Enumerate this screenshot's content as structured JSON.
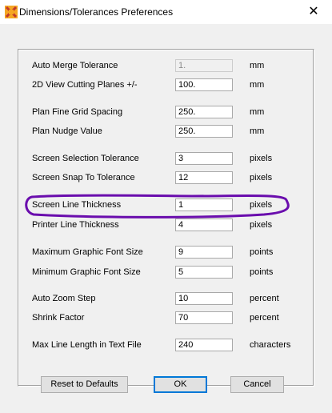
{
  "window": {
    "title": "Dimensions/Tolerances Preferences",
    "close_glyph": "✕",
    "icon": "app-icon"
  },
  "rows": [
    {
      "label": "Auto Merge Tolerance",
      "value": "1.",
      "unit": "mm",
      "disabled": true
    },
    {
      "label": "2D View Cutting Planes +/-",
      "value": "100.",
      "unit": "mm",
      "disabled": false
    },
    {
      "label": "Plan Fine Grid Spacing",
      "value": "250.",
      "unit": "mm",
      "disabled": false
    },
    {
      "label": "Plan Nudge Value",
      "value": "250.",
      "unit": "mm",
      "disabled": false
    },
    {
      "label": "Screen Selection Tolerance",
      "value": "3",
      "unit": "pixels",
      "disabled": false
    },
    {
      "label": "Screen Snap To Tolerance",
      "value": "12",
      "unit": "pixels",
      "disabled": false
    },
    {
      "label": "Screen Line Thickness",
      "value": "1",
      "unit": "pixels",
      "disabled": false
    },
    {
      "label": "Printer Line Thickness",
      "value": "4",
      "unit": "pixels",
      "disabled": false
    },
    {
      "label": "Maximum Graphic Font Size",
      "value": "9",
      "unit": "points",
      "disabled": false
    },
    {
      "label": "Minimum Graphic Font Size",
      "value": "5",
      "unit": "points",
      "disabled": false
    },
    {
      "label": "Auto Zoom Step",
      "value": "10",
      "unit": "percent",
      "disabled": false
    },
    {
      "label": "Shrink Factor",
      "value": "70",
      "unit": "percent",
      "disabled": false
    },
    {
      "label": "Max Line Length in Text File",
      "value": "240",
      "unit": "characters",
      "disabled": false
    }
  ],
  "buttons": {
    "reset": "Reset to Defaults",
    "ok": "OK",
    "cancel": "Cancel"
  },
  "annotation": {
    "color": "#6a0dad",
    "highlighted_row": "Screen Line Thickness"
  }
}
